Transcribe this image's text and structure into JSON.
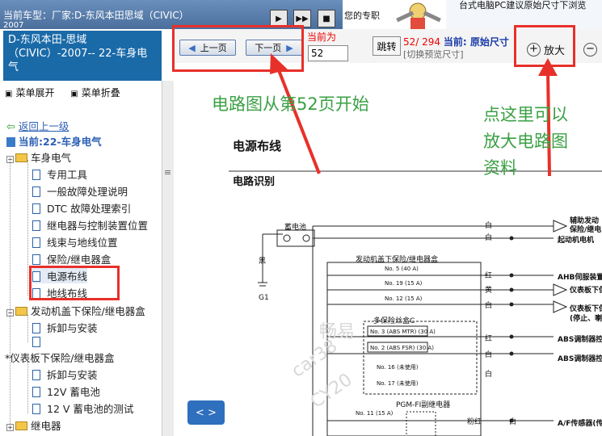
{
  "topbar": {
    "car_model_label": "当前车型：厂家:D-东风本田思域（CIVIC）",
    "car_model_year": "2007",
    "welcome": "您的专职",
    "tip": "台式电脑PC建议原始尺寸下浏览"
  },
  "sidebar": {
    "car_panel": "D-东风本田-思域（CIVIC）-2007-- 22-车身电气",
    "menu_expand": "菜单展开",
    "menu_collapse": "菜单折叠",
    "back_link": "返回上一级",
    "current": "当前:22-车身电气",
    "tree": [
      {
        "label": "车身电气",
        "type": "folder"
      },
      {
        "label": "专用工具",
        "type": "doc"
      },
      {
        "label": "一般故障处理说明",
        "type": "doc"
      },
      {
        "label": "DTC 故障处理索引",
        "type": "doc"
      },
      {
        "label": "继电器与控制装置位置",
        "type": "doc"
      },
      {
        "label": "线束与地线位置",
        "type": "doc"
      },
      {
        "label": "保险/继电器盒",
        "type": "doc"
      },
      {
        "label": "电源布线",
        "type": "doc"
      },
      {
        "label": "地线布线",
        "type": "doc"
      },
      {
        "label": "发动机盖下保险/继电器盒",
        "type": "folder"
      },
      {
        "label": "拆卸与安装",
        "type": "doc"
      },
      {
        "label": "",
        "type": "doc"
      },
      {
        "label": "*仪表板下保险/继电器盒",
        "type": "folder"
      },
      {
        "label": "拆卸与安装",
        "type": "doc"
      },
      {
        "label": "12V 蓄电池",
        "type": "doc"
      },
      {
        "label": "12 V 蓄电池的测试",
        "type": "doc"
      },
      {
        "label": "继电器",
        "type": "folder"
      }
    ]
  },
  "nav": {
    "prev_label": "上一页",
    "next_label": "下一页",
    "current_page_label": "当前为",
    "page_value": "52",
    "jump_label": "跳转",
    "page_current": "52",
    "page_total": "294",
    "size_label": "当前: 原始尺寸",
    "switch_size": "[切换预览尺寸]",
    "zoom_in_label": "放大"
  },
  "annotations": {
    "start_page": "电路图从第52页开始",
    "zoom_hint_1": "点这里可以",
    "zoom_hint_2": "放大电路图",
    "zoom_hint_3": "资料"
  },
  "diagram": {
    "title": "电源布线",
    "subtitle": "电路识别",
    "battery": "蓄电池",
    "black": "黑",
    "g1": "G1",
    "engine_box": "发动机盖下保险/继电器盒",
    "multi_fuse": "多保险丝盒C",
    "fuses": [
      "No. 5 (40 A)",
      "No. 19 (15 A)",
      "No. 12 (15 A)",
      "No. 3 (ABS MTR) (30 A)",
      "No. 2 (ABS FSR) (30 A)",
      "No. 16 (未使用)",
      "No. 17 (未使用)",
      "No. 11 (15 A)"
    ],
    "relay": "PGM-FI副继电器",
    "wires": [
      "白",
      "白",
      "红",
      "黄",
      "白",
      "红",
      "白",
      "白",
      "粉红",
      "白"
    ],
    "right_labels": [
      "辅助发动",
      "保险/继电",
      "起动机电机",
      "AHB伺服装置",
      "仪表板下保",
      "仪表板下保",
      "(停止、喇",
      "ABS调制器控制",
      "ABS调制器控制",
      "A/F传感器(传感"
    ],
    "nav_arrows": "< >",
    "watermark_1": "畅易",
    "watermark_2": "car38",
    "watermark_3": "CY20"
  }
}
